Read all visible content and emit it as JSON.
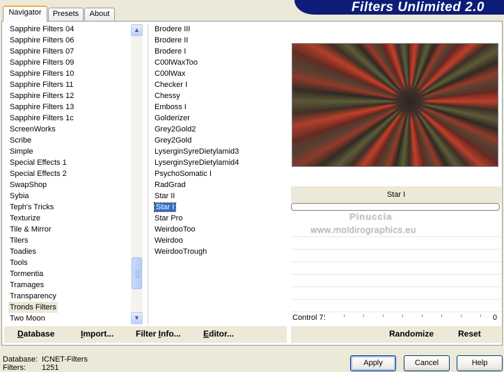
{
  "tabs": [
    {
      "label": "Navigator",
      "active": true
    },
    {
      "label": "Presets",
      "active": false
    },
    {
      "label": "About",
      "active": false
    }
  ],
  "header": {
    "title": "Filters Unlimited 2.0"
  },
  "categories": [
    "Sapphire Filters 04",
    "Sapphire Filters 06",
    "Sapphire Filters 07",
    "Sapphire Filters 09",
    "Sapphire Filters 10",
    "Sapphire Filters 11",
    "Sapphire Filters 12",
    "Sapphire Filters 13",
    "Sapphire Filters 1c",
    "ScreenWorks",
    "Scribe",
    "Simple",
    "Special Effects 1",
    "Special Effects 2",
    "SwapShop",
    "Sybia",
    "Teph's Tricks",
    "Texturize",
    "Tile & Mirror",
    "Tilers",
    "Toadies",
    "Tools",
    "Tormentia",
    "Tramages",
    "Transparency",
    "Tronds Filters",
    "Two Moon"
  ],
  "selected_category": "Tronds Filters",
  "filters": [
    "Brodere III",
    "Brodere II",
    "Brodere I",
    "C00lWaxToo",
    "C00lWax",
    "Checker I",
    "Chessy",
    "Emboss I",
    "Golderizer",
    "Grey2Gold2",
    "Grey2Gold",
    "LyserginSyreDietylamid3",
    "LyserginSyreDietylamid4",
    "PsychoSomatic I",
    "RadGrad",
    "Star II",
    "Star I",
    "Star Pro",
    "WeirdooToo",
    "Weirdoo",
    "WeirdooTrough"
  ],
  "selected_filter": "Star I",
  "left_buttons": [
    {
      "label": "Database",
      "accesskey_char": "D"
    },
    {
      "label": "Import...",
      "accesskey_char": "I"
    },
    {
      "label": "Filter Info...",
      "accesskey_char": "I"
    },
    {
      "label": "Editor...",
      "accesskey_char": "E"
    }
  ],
  "right_buttons": [
    {
      "label": "Randomize"
    },
    {
      "label": "Reset"
    }
  ],
  "preview": {
    "filter_name": "Star I"
  },
  "watermark": {
    "line1": "Pinuccia",
    "line2": "www.moldirographics.eu"
  },
  "control": {
    "label": "Control 7:",
    "value": "0"
  },
  "footer": {
    "database_label": "Database:",
    "database_value": "ICNET-Filters",
    "filters_label": "Filters:",
    "filters_value": "1251",
    "apply": "Apply",
    "cancel": "Cancel",
    "help": "Help"
  },
  "colors": {
    "banner": "#0d1c77",
    "selection": "#316ac5",
    "window_bg": "#ece9d8"
  }
}
